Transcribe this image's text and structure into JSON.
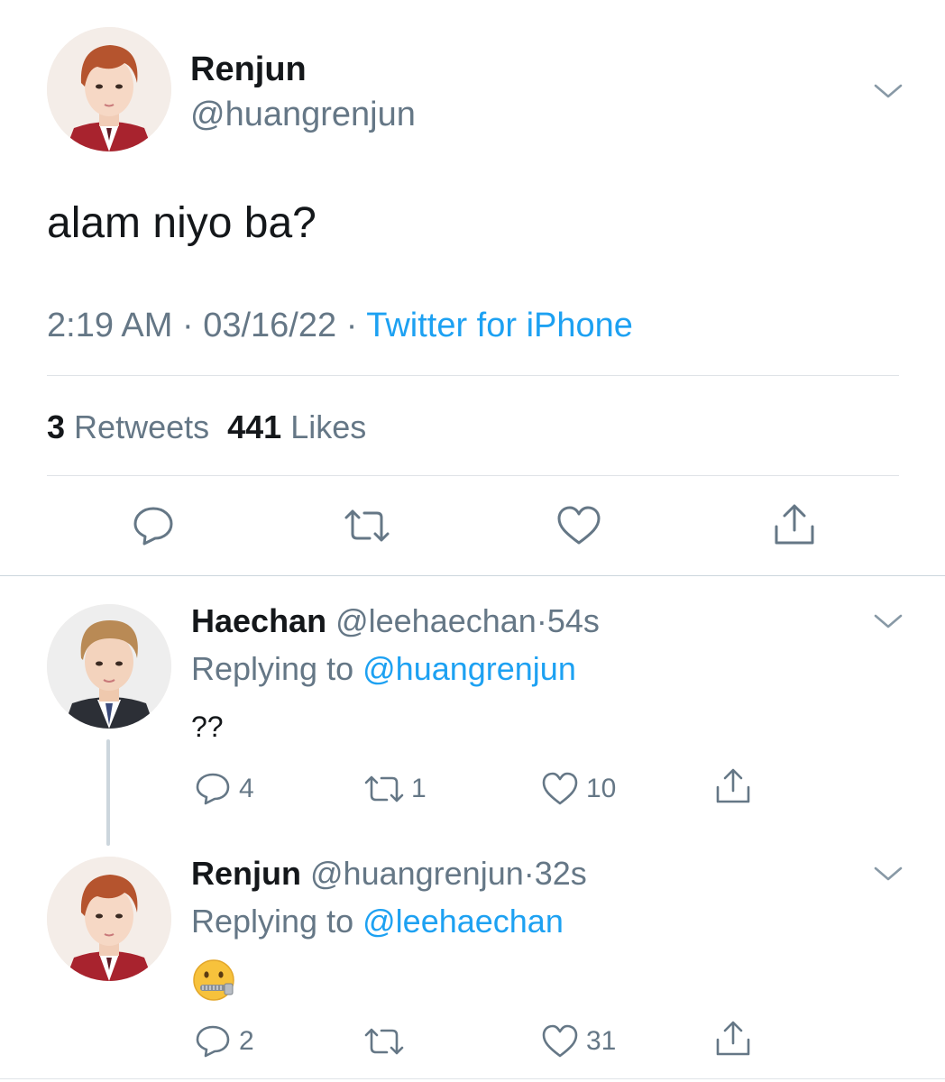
{
  "main_tweet": {
    "author_name": "Renjun",
    "author_handle": "@huangrenjun",
    "text": "alam niyo ba?",
    "time": "2:19 AM",
    "separator": "·",
    "date": "03/16/22",
    "source": "Twitter for iPhone",
    "retweets_count": "3",
    "retweets_label": "Retweets",
    "likes_count": "441",
    "likes_label": "Likes"
  },
  "replies": [
    {
      "author_name": "Haechan",
      "author_handle": "@leehaechan",
      "separator": "·",
      "time": "54s",
      "replying_label": "Replying to",
      "replying_to": "@huangrenjun",
      "text": "??",
      "reply_count": "4",
      "retweet_count": "1",
      "like_count": "10"
    },
    {
      "author_name": "Renjun",
      "author_handle": "@huangrenjun",
      "separator": "·",
      "time": "32s",
      "replying_label": "Replying to",
      "replying_to": "@leehaechan",
      "text": "🤐",
      "reply_count": "2",
      "retweet_count": "",
      "like_count": "31"
    }
  ],
  "icons": {
    "reply": "speech-bubble-icon",
    "retweet": "retweet-arrows-icon",
    "like": "heart-outline-icon",
    "share": "share-upload-icon",
    "menu": "chevron-down-icon"
  },
  "colors": {
    "link": "#1da1f2",
    "secondary_text": "#657786",
    "primary_text": "#14171a",
    "divider": "#dfe3e7",
    "icon": "#657786"
  }
}
